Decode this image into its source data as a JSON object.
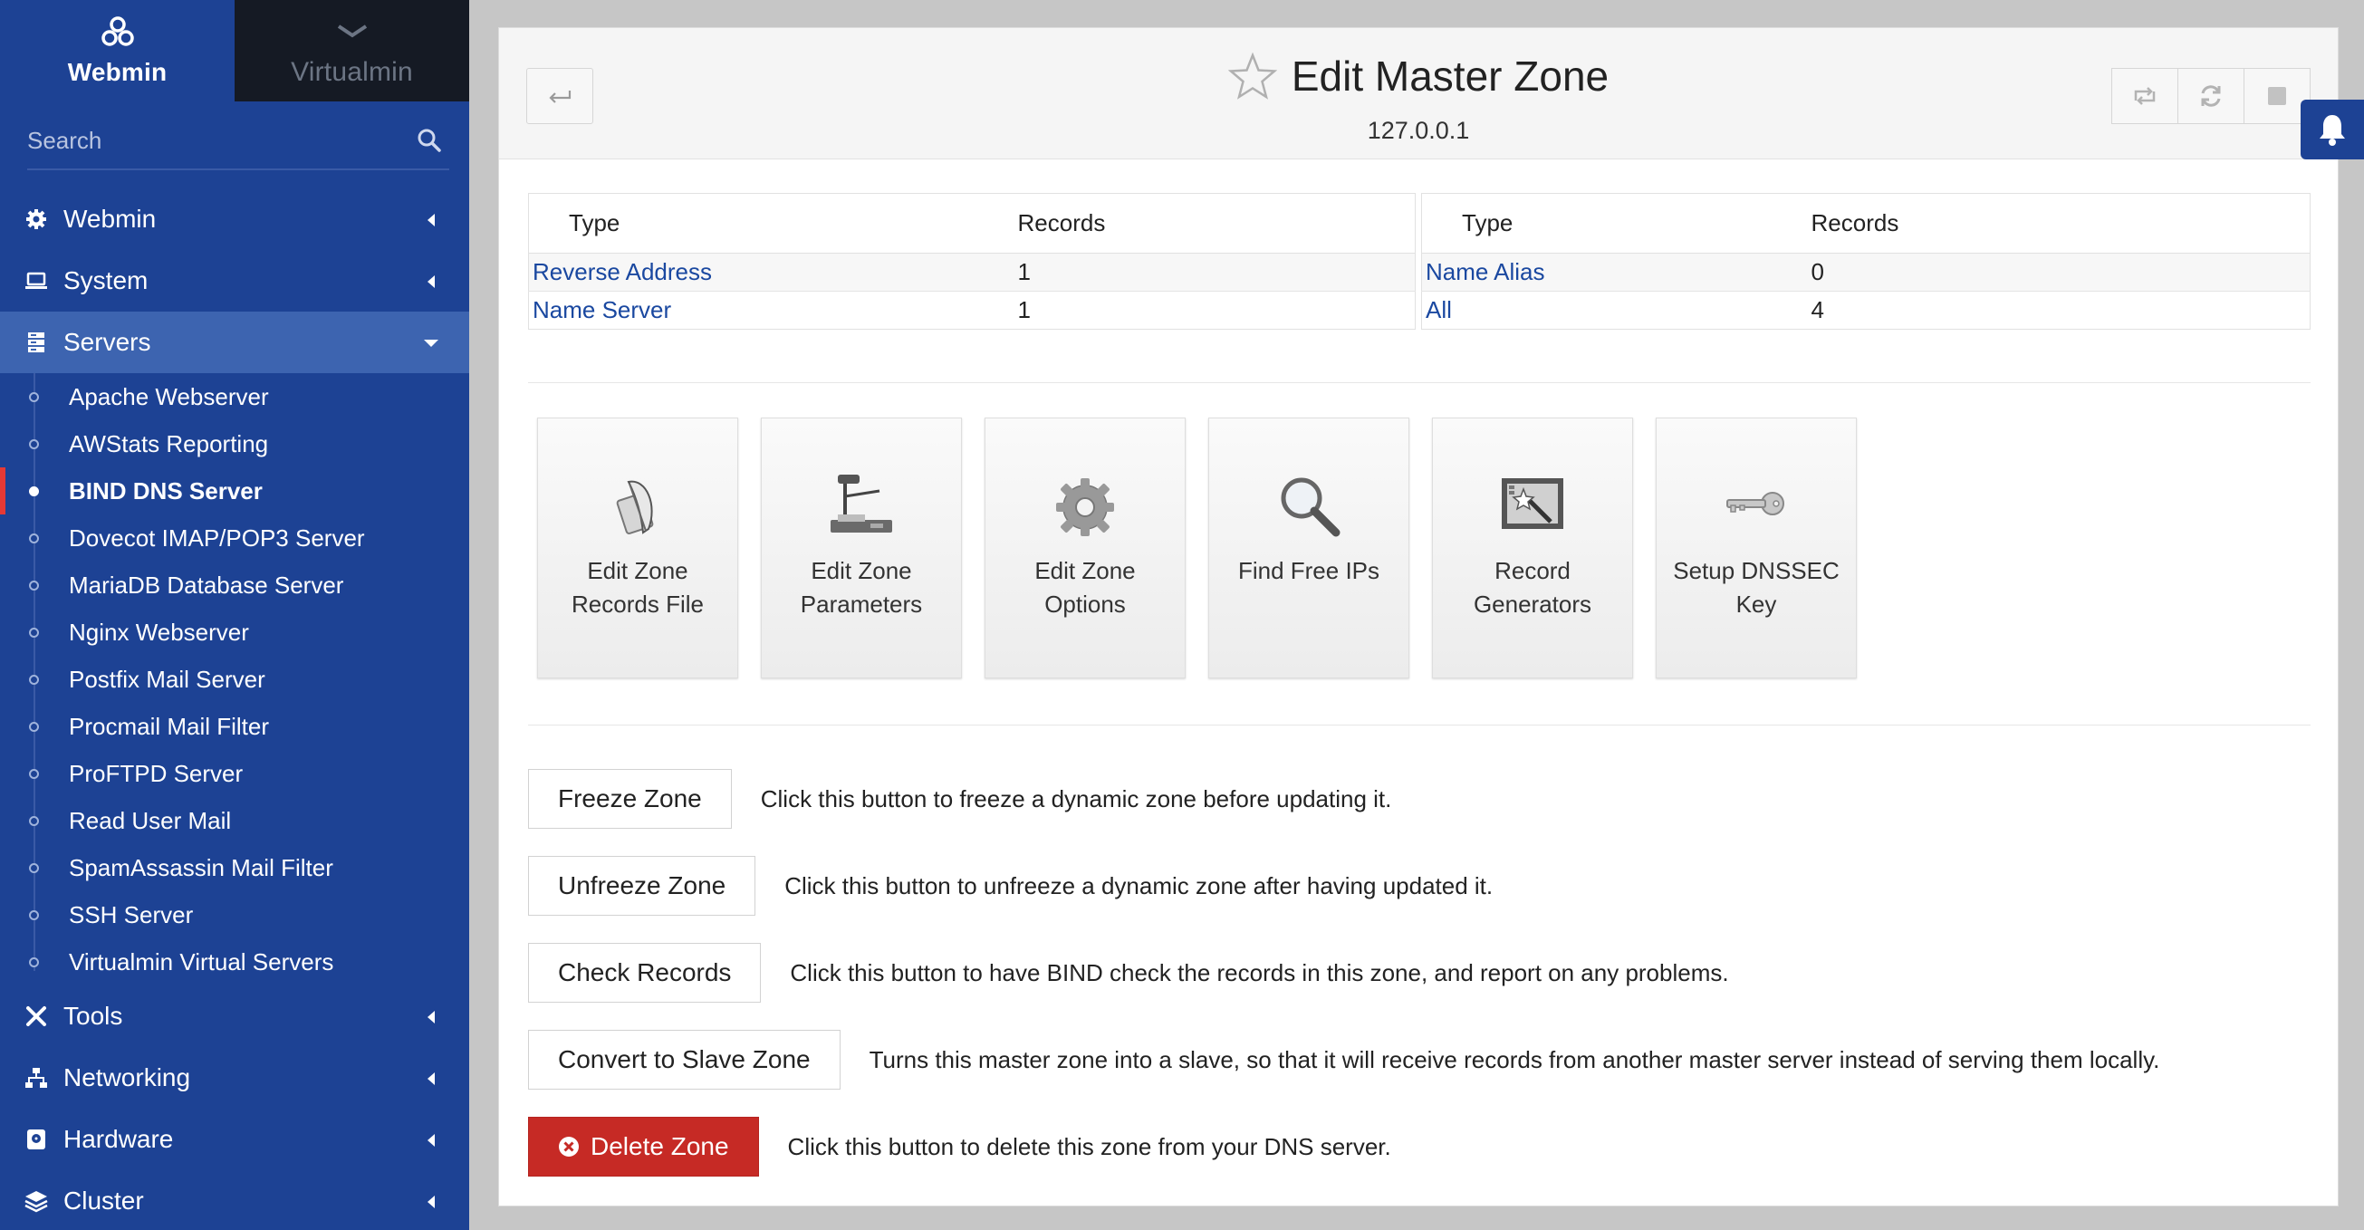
{
  "brand": {
    "webmin_label": "Webmin",
    "virtualmin_label": "Virtualmin"
  },
  "search": {
    "placeholder": "Search"
  },
  "menu": {
    "webmin": "Webmin",
    "system": "System",
    "servers": "Servers",
    "servers_items": [
      "Apache Webserver",
      "AWStats Reporting",
      "BIND DNS Server",
      "Dovecot IMAP/POP3 Server",
      "MariaDB Database Server",
      "Nginx Webserver",
      "Postfix Mail Server",
      "Procmail Mail Filter",
      "ProFTPD Server",
      "Read User Mail",
      "SpamAssassin Mail Filter",
      "SSH Server",
      "Virtualmin Virtual Servers"
    ],
    "active_server": "BIND DNS Server",
    "tools": "Tools",
    "networking": "Networking",
    "hardware": "Hardware",
    "cluster": "Cluster"
  },
  "header": {
    "title": "Edit Master Zone",
    "subtitle": "127.0.0.1"
  },
  "records_tables": {
    "left": {
      "headers": [
        "Type",
        "Records"
      ],
      "rows": [
        {
          "type": "Reverse Address",
          "count": "1"
        },
        {
          "type": "Name Server",
          "count": "1"
        }
      ]
    },
    "right": {
      "headers": [
        "Type",
        "Records"
      ],
      "rows": [
        {
          "type": "Name Alias",
          "count": "0"
        },
        {
          "type": "All",
          "count": "4"
        }
      ]
    }
  },
  "icon_buttons": {
    "edit_records_file": "Edit Zone Records File",
    "edit_parameters": "Edit Zone Parameters",
    "edit_options": "Edit Zone Options",
    "find_free_ips": "Find Free IPs",
    "record_generators": "Record Generators",
    "setup_dnssec": "Setup DNSSEC Key"
  },
  "actions": {
    "freeze": {
      "label": "Freeze Zone",
      "desc": "Click this button to freeze a dynamic zone before updating it."
    },
    "unfreeze": {
      "label": "Unfreeze Zone",
      "desc": "Click this button to unfreeze a dynamic zone after having updated it."
    },
    "check": {
      "label": "Check Records",
      "desc": "Click this button to have BIND check the records in this zone, and report on any problems."
    },
    "convert": {
      "label": "Convert to Slave Zone",
      "desc": "Turns this master zone into a slave, so that it will receive records from another master server instead of serving them locally."
    },
    "delete": {
      "label": "Delete Zone",
      "desc": "Click this button to delete this zone from your DNS server."
    }
  },
  "colors": {
    "sidebar": "#1d4294",
    "sidebar_active": "#3d64b0",
    "link": "#1a48a0",
    "danger": "#c62a25",
    "active_marker": "#e53935"
  }
}
